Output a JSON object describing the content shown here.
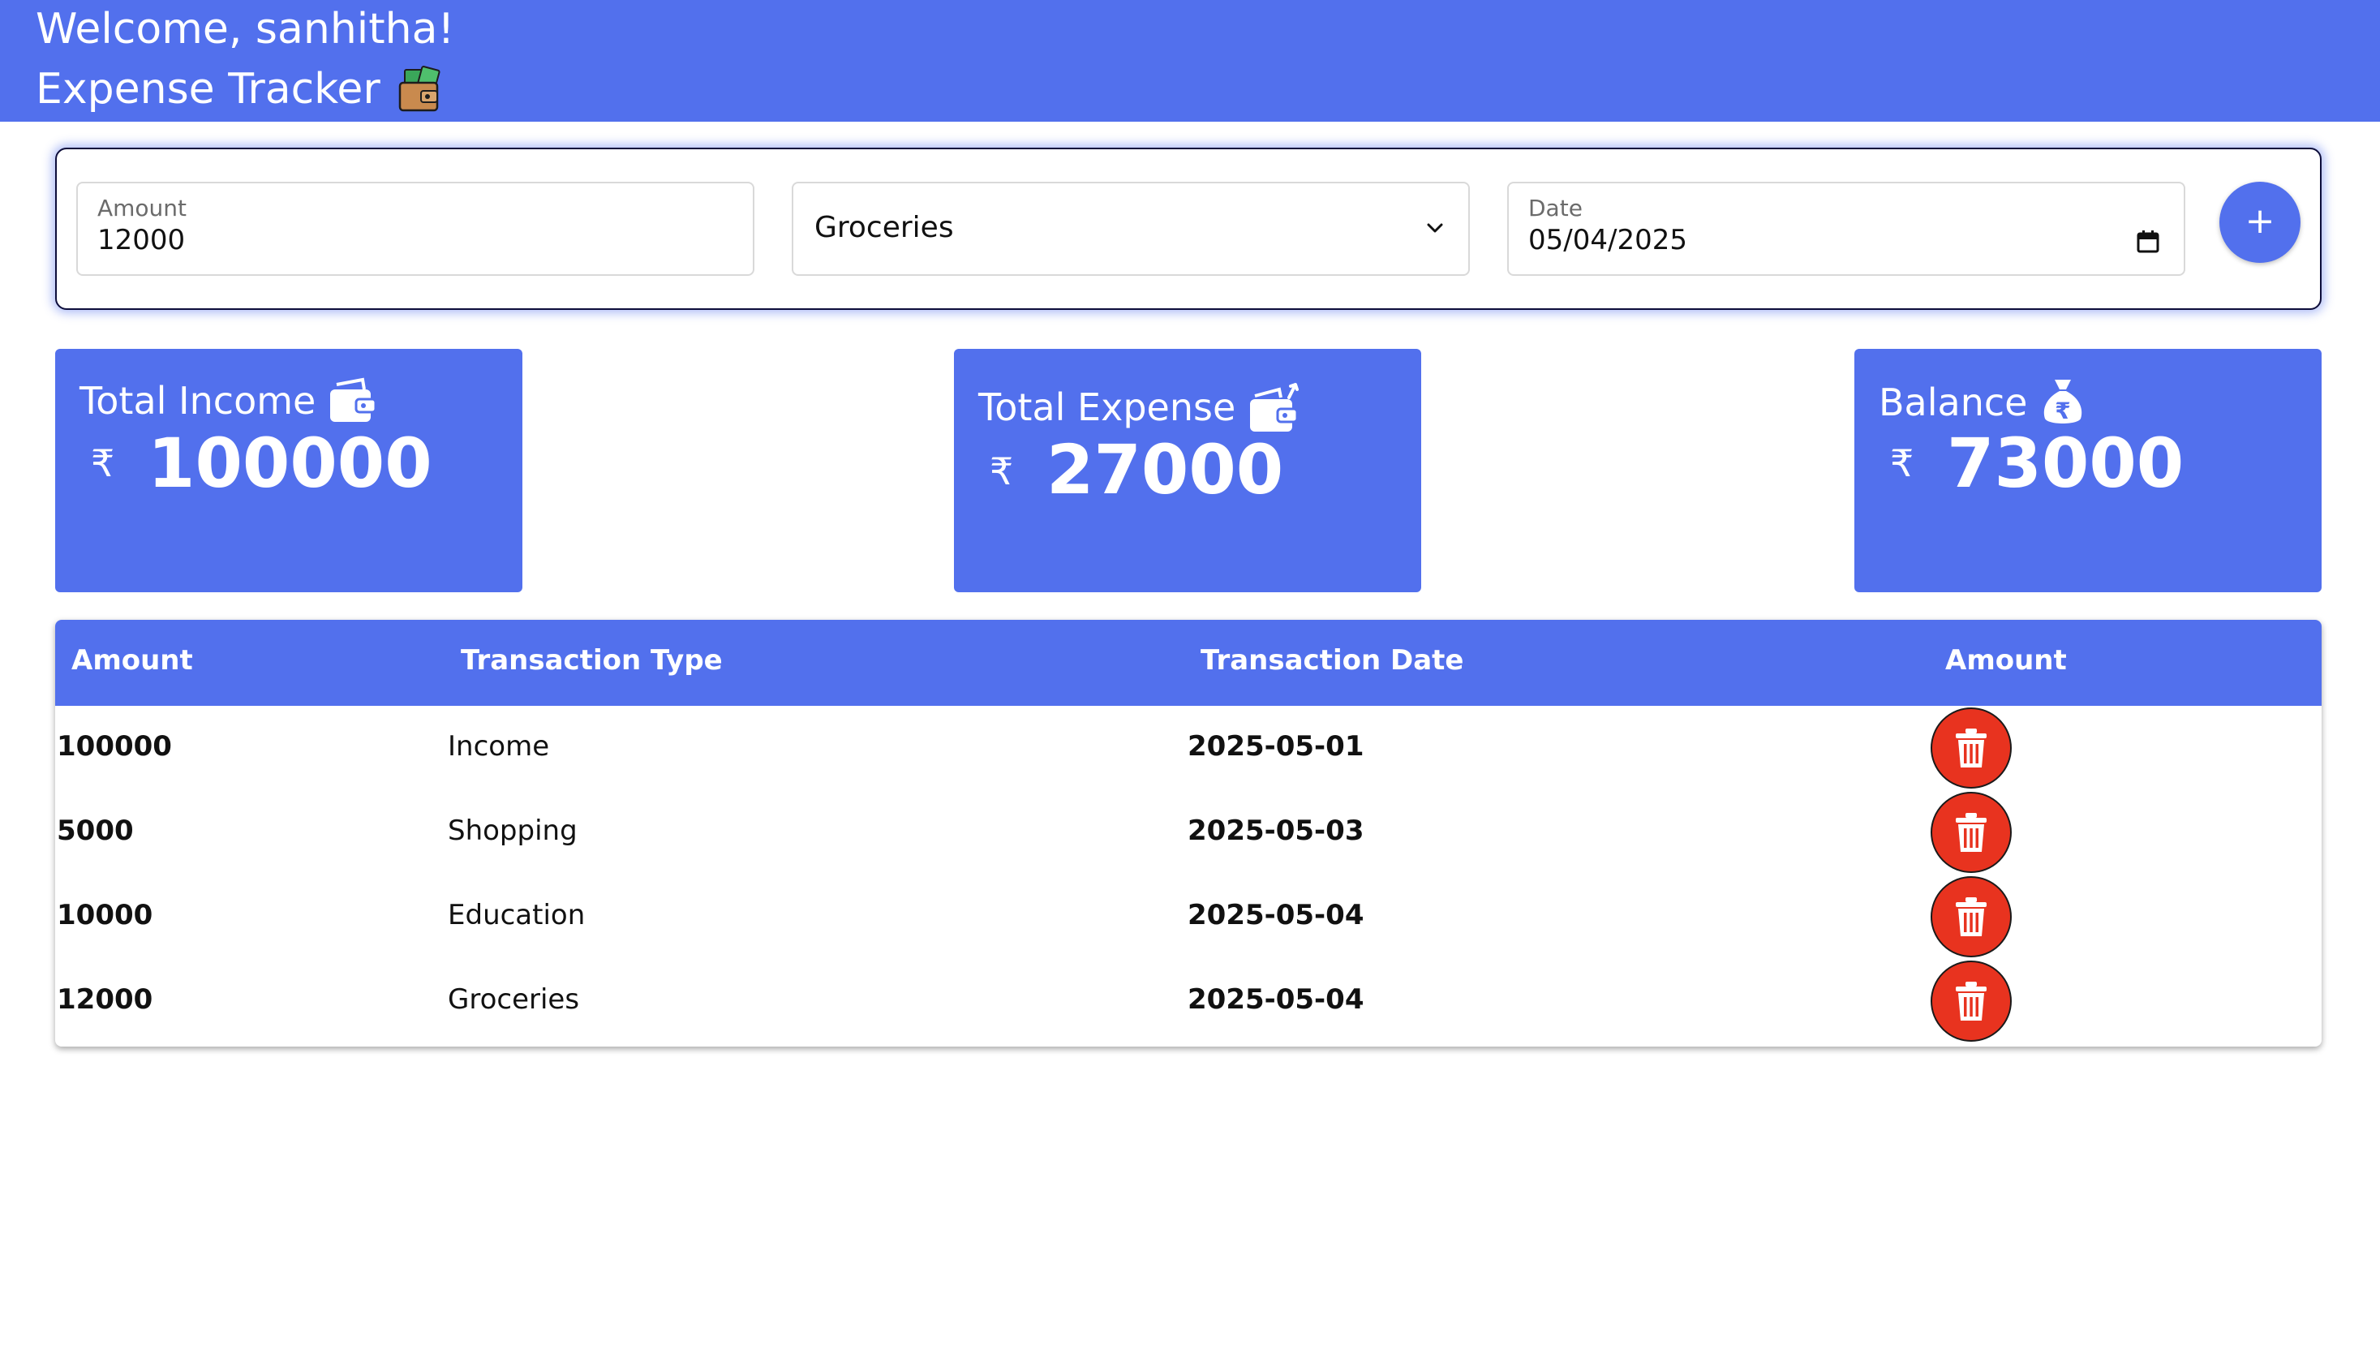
{
  "header": {
    "welcome": "Welcome, sanhitha!",
    "app_title": "Expense Tracker",
    "icon": "wallet-money-icon"
  },
  "form": {
    "amount_label": "Amount",
    "amount_value": "12000",
    "category_value": "Groceries",
    "date_label": "Date",
    "date_value": "05/04/2025",
    "add_label": "+"
  },
  "stats": {
    "income": {
      "title": "Total Income",
      "currency": "₹",
      "value": "100000",
      "icon": "wallet-icon"
    },
    "expense": {
      "title": "Total Expense",
      "currency": "₹",
      "value": "27000",
      "icon": "wallet-out-icon"
    },
    "balance": {
      "title": "Balance",
      "currency": "₹",
      "value": "73000",
      "icon": "money-bag-icon"
    }
  },
  "table": {
    "headers": [
      "Amount",
      "Transaction Type",
      "Transaction Date",
      "Amount"
    ],
    "rows": [
      {
        "amount": "100000",
        "type": "Income",
        "date": "2025-05-01"
      },
      {
        "amount": "5000",
        "type": "Shopping",
        "date": "2025-05-03"
      },
      {
        "amount": "10000",
        "type": "Education",
        "date": "2025-05-04"
      },
      {
        "amount": "12000",
        "type": "Groceries",
        "date": "2025-05-04"
      }
    ]
  },
  "colors": {
    "primary": "#5270ed",
    "delete": "#e8331f",
    "white": "#ffffff"
  }
}
